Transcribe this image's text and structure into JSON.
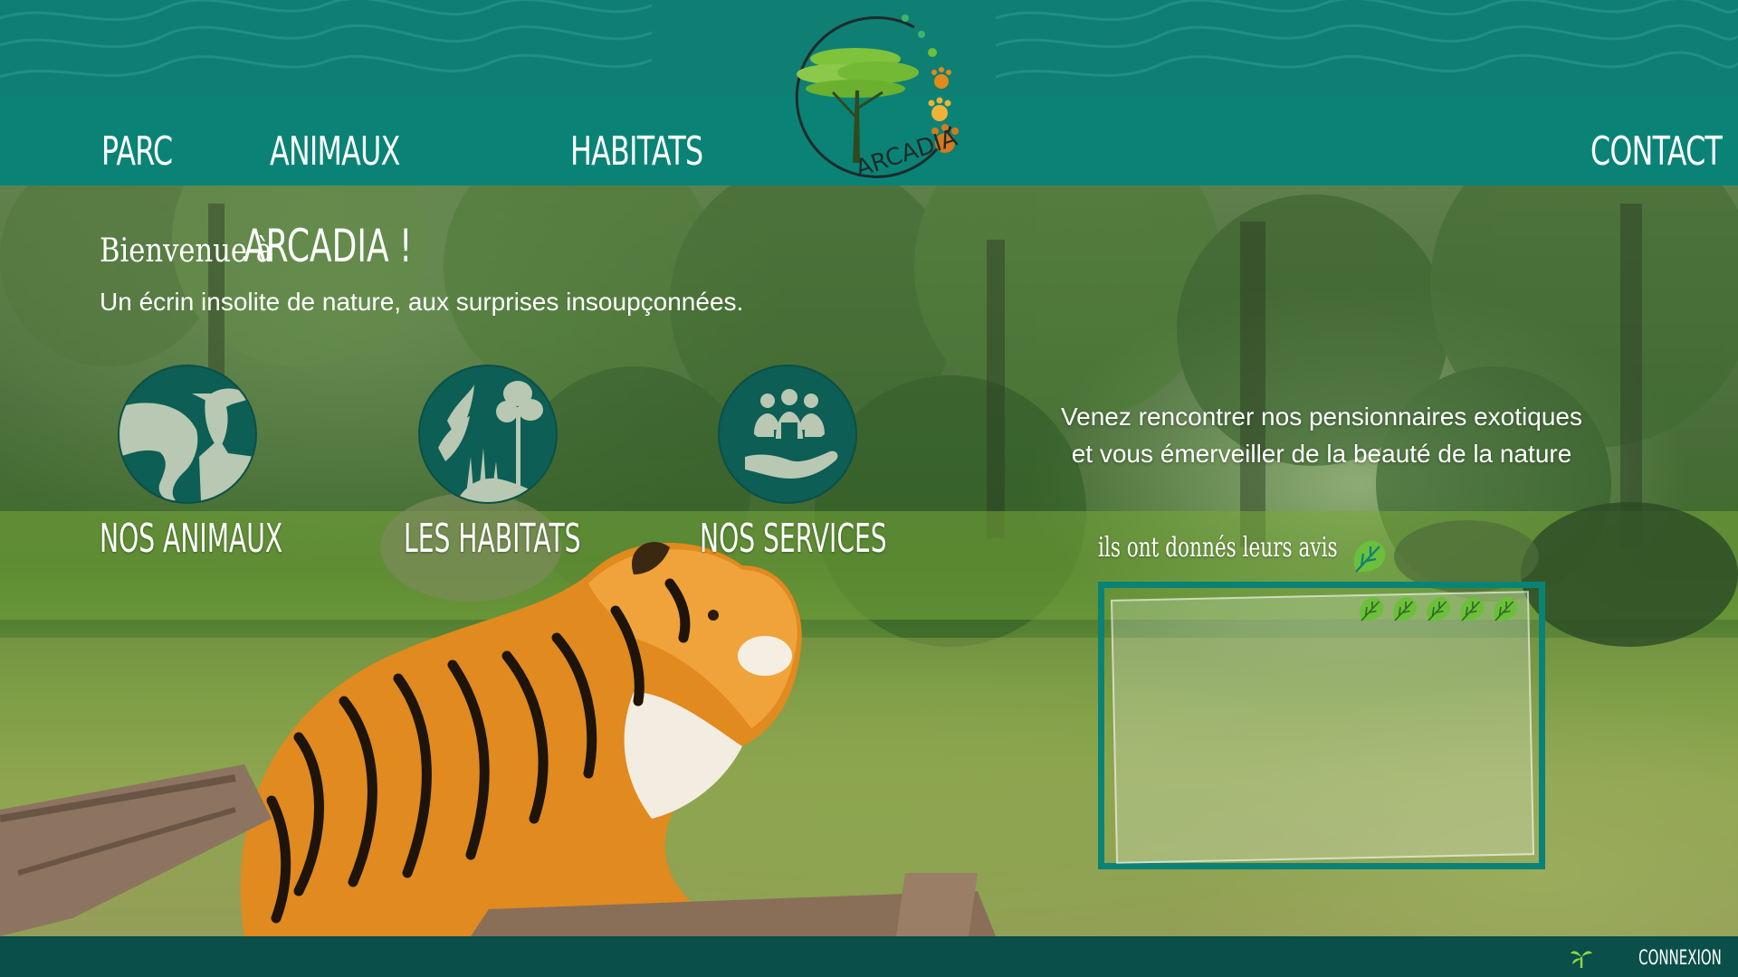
{
  "colors": {
    "header_teal": "#0f7f74",
    "navbar_teal": "#0a8376",
    "circle_dark_teal": "#0d5e54",
    "footer_dark_teal": "#0a4f49",
    "leaf_green": "#6cbf3a",
    "paw_orange": "#e28a1a",
    "text_white": "#ffffff"
  },
  "nav": {
    "items": [
      "PARC",
      "ANIMAUX",
      "HABITATS",
      "CONTACT"
    ]
  },
  "logo": {
    "text": "ARCADIA",
    "icon": "acacia-tree-icon"
  },
  "hero": {
    "welcome_prefix": "Bienvenue à",
    "welcome_name": "ARCADIA !",
    "tagline": "Un écrin insolite de nature, aux surprises insoupçonnées."
  },
  "features": [
    {
      "label": "NOS ANIMAUX",
      "icon": "animals-icon"
    },
    {
      "label": "LES HABITATS",
      "icon": "habitats-icon"
    },
    {
      "label": "NOS SERVICES",
      "icon": "services-icon"
    }
  ],
  "invite": {
    "line1": "Venez rencontrer nos pensionnaires exotiques",
    "line2": "et vous émerveiller de la beauté de la nature"
  },
  "reviews": {
    "title": "ils ont donnés leurs avis",
    "title_icon": "monstera-leaf-icon",
    "rating": 5,
    "rating_icon": "monstera-leaf-icon"
  },
  "footer": {
    "login_label": "CONNEXION",
    "login_icon": "palm-sprout-icon"
  }
}
